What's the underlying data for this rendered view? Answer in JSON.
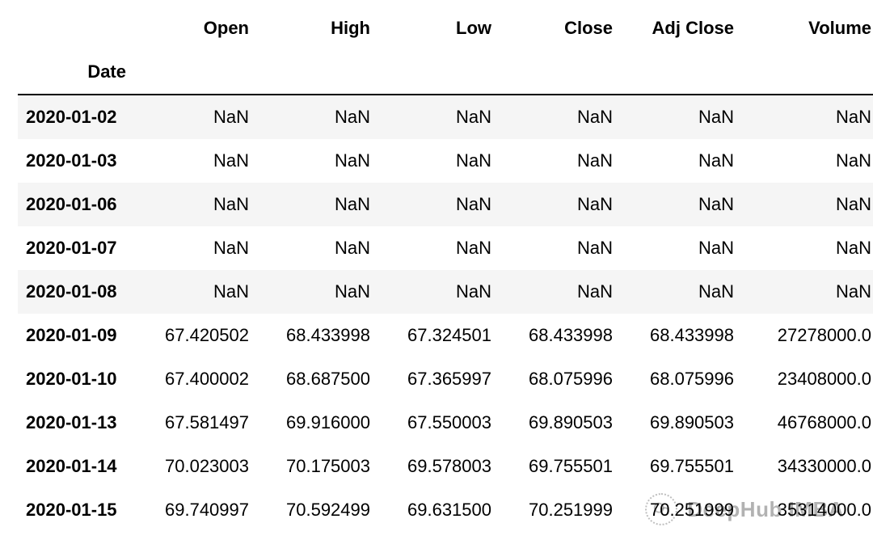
{
  "columns": {
    "index_name": "Date",
    "open": "Open",
    "high": "High",
    "low": "Low",
    "close": "Close",
    "adj_close": "Adj Close",
    "volume": "Volume"
  },
  "rows": [
    {
      "date": "2020-01-02",
      "open": "NaN",
      "high": "NaN",
      "low": "NaN",
      "close": "NaN",
      "adj": "NaN",
      "vol": "NaN",
      "alt": true
    },
    {
      "date": "2020-01-03",
      "open": "NaN",
      "high": "NaN",
      "low": "NaN",
      "close": "NaN",
      "adj": "NaN",
      "vol": "NaN",
      "alt": false
    },
    {
      "date": "2020-01-06",
      "open": "NaN",
      "high": "NaN",
      "low": "NaN",
      "close": "NaN",
      "adj": "NaN",
      "vol": "NaN",
      "alt": true
    },
    {
      "date": "2020-01-07",
      "open": "NaN",
      "high": "NaN",
      "low": "NaN",
      "close": "NaN",
      "adj": "NaN",
      "vol": "NaN",
      "alt": false
    },
    {
      "date": "2020-01-08",
      "open": "NaN",
      "high": "NaN",
      "low": "NaN",
      "close": "NaN",
      "adj": "NaN",
      "vol": "NaN",
      "alt": true
    },
    {
      "date": "2020-01-09",
      "open": "67.420502",
      "high": "68.433998",
      "low": "67.324501",
      "close": "68.433998",
      "adj": "68.433998",
      "vol": "27278000.0",
      "alt": false
    },
    {
      "date": "2020-01-10",
      "open": "67.400002",
      "high": "68.687500",
      "low": "67.365997",
      "close": "68.075996",
      "adj": "68.075996",
      "vol": "23408000.0",
      "alt": false
    },
    {
      "date": "2020-01-13",
      "open": "67.581497",
      "high": "69.916000",
      "low": "67.550003",
      "close": "69.890503",
      "adj": "69.890503",
      "vol": "46768000.0",
      "alt": false
    },
    {
      "date": "2020-01-14",
      "open": "70.023003",
      "high": "70.175003",
      "low": "69.578003",
      "close": "69.755501",
      "adj": "69.755501",
      "vol": "34330000.0",
      "alt": false
    },
    {
      "date": "2020-01-15",
      "open": "69.740997",
      "high": "70.592499",
      "low": "69.631500",
      "close": "70.251999",
      "adj": "70.251999",
      "vol": "35314000.0",
      "alt": false
    }
  ],
  "watermark": {
    "text": "DeepHub IMBA"
  }
}
